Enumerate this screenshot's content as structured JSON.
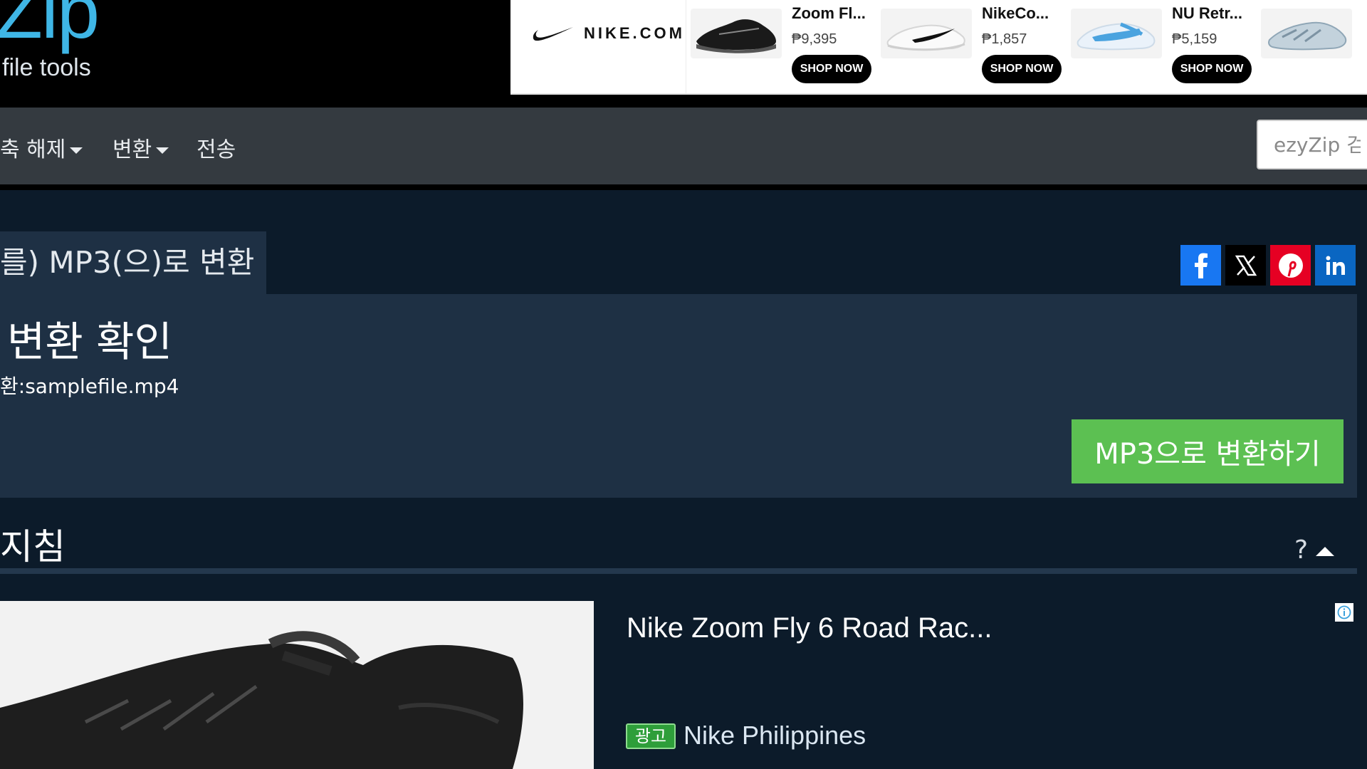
{
  "logo": {
    "main": "Zip",
    "sub": "file tools"
  },
  "top_ad": {
    "brand": "NIKE.COM",
    "products": [
      {
        "name": "Zoom Fl...",
        "price": "₱9,395",
        "cta": "SHOP NOW"
      },
      {
        "name": "NikeCo...",
        "price": "₱1,857",
        "cta": "SHOP NOW"
      },
      {
        "name": "NU Retr...",
        "price": "₱5,159",
        "cta": "SHOP NOW"
      }
    ]
  },
  "nav": {
    "items": [
      {
        "label": "축 해제"
      },
      {
        "label": "변환"
      },
      {
        "label": "전송"
      }
    ],
    "search_placeholder": "ezyZip 검"
  },
  "main": {
    "tab_title": "를) MP3(으)로 변환",
    "heading": "변환 확인",
    "file_line": "환:samplefile.mp4",
    "convert_button": "MP3으로 변환하기",
    "guide_title": "지침",
    "help_symbol": "?"
  },
  "social": [
    {
      "name": "facebook",
      "color": "#1877f2"
    },
    {
      "name": "x",
      "color": "#000000"
    },
    {
      "name": "pinterest",
      "color": "#e60023"
    },
    {
      "name": "linkedin",
      "color": "#0a66c2"
    }
  ],
  "bottom_ad": {
    "headline": "Nike Zoom Fly 6 Road Rac...",
    "badge": "광고",
    "advertiser": "Nike Philippines"
  },
  "colors": {
    "accent_green": "#5cc052",
    "logo_blue": "#3fb6e6",
    "nav_bg": "#343a40",
    "panel_bg": "#1e3044",
    "page_bg": "#0c1b2a"
  }
}
